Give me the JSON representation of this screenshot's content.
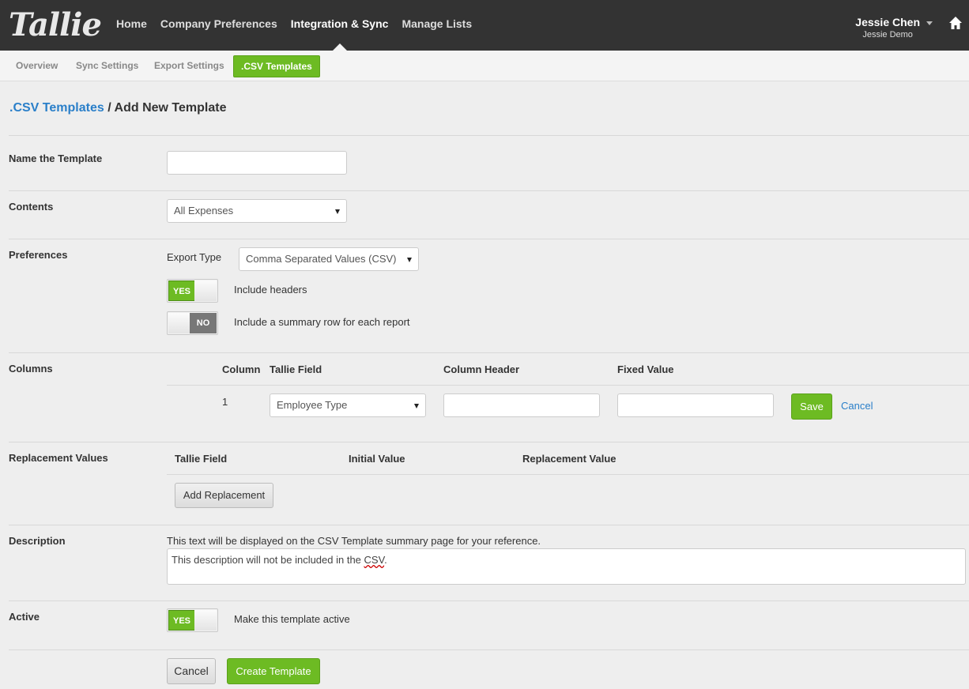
{
  "brand": {
    "logo_text": "Tallie"
  },
  "nav": {
    "items": [
      {
        "label": "Home",
        "active": false
      },
      {
        "label": "Company Preferences",
        "active": false
      },
      {
        "label": "Integration & Sync",
        "active": true
      },
      {
        "label": "Manage Lists",
        "active": false
      }
    ]
  },
  "user": {
    "name": "Jessie Chen",
    "subtitle": "Jessie Demo"
  },
  "subnav": {
    "items": [
      "Overview",
      "Sync Settings",
      "Export Settings",
      ".CSV Templates"
    ],
    "active": ".CSV Templates"
  },
  "breadcrumb": {
    "parent": ".CSV Templates",
    "separator": "/",
    "current": "Add New Template"
  },
  "form": {
    "name_label": "Name the Template",
    "name_value": "",
    "contents_label": "Contents",
    "contents_value": "All Expenses",
    "preferences_label": "Preferences",
    "export_type_label": "Export Type",
    "export_type_value": "Comma Separated Values (CSV)",
    "include_headers": {
      "state": "YES",
      "label": "Include headers"
    },
    "summary_row": {
      "state": "NO",
      "label": "Include a summary row for each report"
    },
    "columns_label": "Columns",
    "columns_headers": [
      "Column",
      "Tallie Field",
      "Column Header",
      "Fixed Value"
    ],
    "column_row": {
      "number": "1",
      "field": "Employee Type",
      "header": "",
      "fixed": ""
    },
    "save_label": "Save",
    "cancel_link": "Cancel",
    "replacement_label": "Replacement Values",
    "replacement_headers": [
      "Tallie Field",
      "Initial Value",
      "Replacement Value"
    ],
    "add_replacement_label": "Add Replacement",
    "description_label": "Description",
    "description_help": "This text will be displayed on the CSV Template summary page for your reference.",
    "description_text_prefix": "This description will not be included in the ",
    "description_text_word": "CSV",
    "description_text_suffix": ".",
    "active_label": "Active",
    "active_toggle": {
      "state": "YES",
      "label": "Make this template active"
    },
    "cancel_button": "Cancel",
    "create_button": "Create Template"
  },
  "colors": {
    "topbar": "#333333",
    "accent_green": "#6dbb23",
    "link_blue": "#2a7fc9"
  }
}
